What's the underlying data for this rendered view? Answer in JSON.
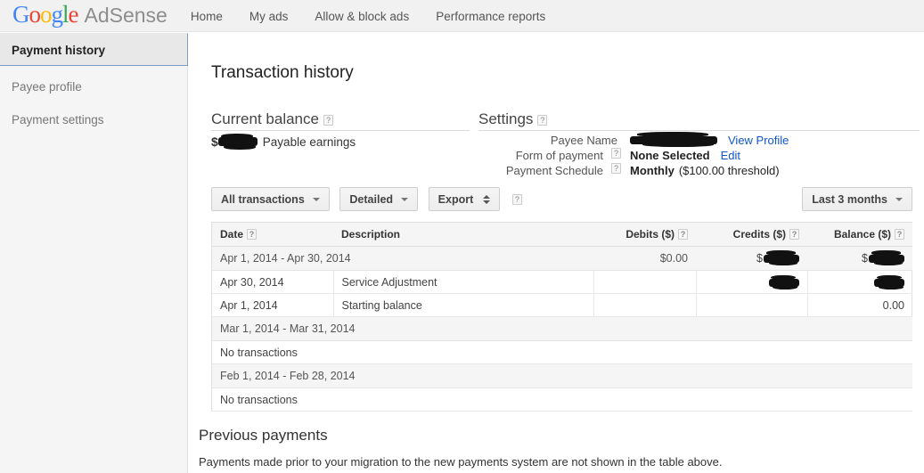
{
  "topbar": {
    "logo": {
      "g1": "G",
      "o1": "o",
      "o2": "o",
      "g2": "g",
      "l1": "l",
      "e1": "e"
    },
    "product": "AdSense",
    "nav": [
      {
        "label": "Home"
      },
      {
        "label": "My ads"
      },
      {
        "label": "Allow & block ads"
      },
      {
        "label": "Performance reports"
      }
    ]
  },
  "sidebar": {
    "items": [
      {
        "label": "Payment history",
        "selected": true
      },
      {
        "label": "Payee profile",
        "selected": false
      },
      {
        "label": "Payment settings",
        "selected": false
      }
    ]
  },
  "main": {
    "page_title": "Transaction history",
    "current_balance": {
      "heading": "Current balance",
      "help": "?",
      "amount_prefix": "$",
      "amount_redacted": true,
      "label": "Payable earnings"
    },
    "settings": {
      "heading": "Settings",
      "help": "?",
      "rows": [
        {
          "label": "Payee Name",
          "has_help": false,
          "value": "",
          "value_redacted": true,
          "link": "View Profile"
        },
        {
          "label": "Form of payment",
          "has_help": true,
          "help": "?",
          "value": "None Selected",
          "value_redacted": false,
          "link": "Edit"
        },
        {
          "label": "Payment Schedule",
          "has_help": true,
          "help": "?",
          "value": "Monthly",
          "value_suffix": "($100.00 threshold)",
          "value_redacted": false,
          "link": ""
        }
      ]
    },
    "toolbar": {
      "filter_label": "All transactions",
      "view_label": "Detailed",
      "export_label": "Export",
      "help": "?",
      "range_label": "Last 3 months"
    },
    "table": {
      "columns": [
        {
          "label": "Date",
          "help": "?",
          "align": "left"
        },
        {
          "label": "Description",
          "help": "",
          "align": "left"
        },
        {
          "label": "Debits ($)",
          "help": "?",
          "align": "right"
        },
        {
          "label": "Credits ($)",
          "help": "?",
          "align": "right"
        },
        {
          "label": "Balance ($)",
          "help": "?",
          "align": "right"
        }
      ],
      "rows": [
        {
          "type": "group",
          "date": "Apr 1, 2014 - Apr 30, 2014",
          "description": "",
          "debits": "$0.00",
          "credits_prefix": "$",
          "credits_redacted": true,
          "credits": "",
          "balance_prefix": "$",
          "balance_redacted": true,
          "balance": ""
        },
        {
          "type": "detail",
          "date": "Apr 30, 2014",
          "description": "Service Adjustment",
          "debits": "",
          "credits": "",
          "credits_redacted": true,
          "balance": "",
          "balance_redacted": true
        },
        {
          "type": "detail",
          "date": "Apr 1, 2014",
          "description": "Starting balance",
          "debits": "",
          "credits": "",
          "credits_redacted": false,
          "balance": "0.00",
          "balance_redacted": false
        },
        {
          "type": "group",
          "date": "Mar 1, 2014 - Mar 31, 2014",
          "description": "",
          "debits": "",
          "credits": "",
          "balance": ""
        },
        {
          "type": "empty",
          "date": "No transactions",
          "description": "",
          "debits": "",
          "credits": "",
          "balance": ""
        },
        {
          "type": "group",
          "date": "Feb 1, 2014 - Feb 28, 2014",
          "description": "",
          "debits": "",
          "credits": "",
          "balance": ""
        },
        {
          "type": "empty",
          "date": "No transactions",
          "description": "",
          "debits": "",
          "credits": "",
          "balance": ""
        }
      ]
    },
    "previous_payments": {
      "heading": "Previous payments",
      "note": "Payments made prior to your migration to the new payments system are not shown in the table above."
    }
  }
}
